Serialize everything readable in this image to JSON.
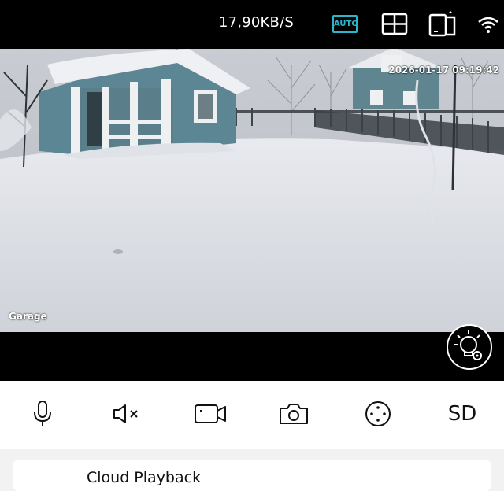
{
  "header": {
    "speed": "17,90KB/S",
    "auto_label": "AUTO",
    "accent_color": "#2bb7c9",
    "icons": [
      "grid-layout-icon",
      "rotate-screen-icon",
      "wifi-icon"
    ]
  },
  "video": {
    "timestamp": "2026-01-17 09:19:42",
    "camera_name": "Garage",
    "light_button_icon": "light-settings-icon"
  },
  "controls": {
    "items": [
      "microphone-icon",
      "mute-speaker-icon",
      "record-video-icon",
      "snapshot-camera-icon",
      "ptz-direction-icon"
    ],
    "sd_label": "SD"
  },
  "bottom_card": {
    "label": "Cloud Playback"
  }
}
